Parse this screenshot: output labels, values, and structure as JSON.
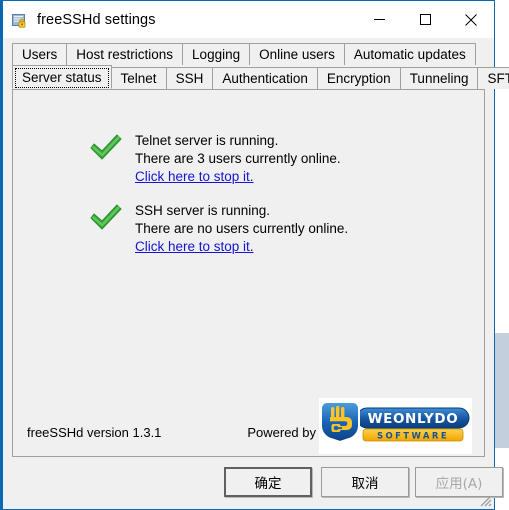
{
  "window": {
    "title": "freeSSHd settings",
    "icon": "app-lock-icon",
    "controls": {
      "minimize": "—",
      "maximize": "□",
      "close": "✕"
    },
    "border_color": "#0a67b2"
  },
  "tabs": {
    "row1": [
      {
        "label": "Users",
        "selected": false
      },
      {
        "label": "Host restrictions",
        "selected": false
      },
      {
        "label": "Logging",
        "selected": false
      },
      {
        "label": "Online users",
        "selected": false
      },
      {
        "label": "Automatic updates",
        "selected": false
      }
    ],
    "row2": [
      {
        "label": "Server status",
        "selected": true
      },
      {
        "label": "Telnet",
        "selected": false
      },
      {
        "label": "SSH",
        "selected": false
      },
      {
        "label": "Authentication",
        "selected": false
      },
      {
        "label": "Encryption",
        "selected": false
      },
      {
        "label": "Tunneling",
        "selected": false
      },
      {
        "label": "SFTP",
        "selected": false
      }
    ]
  },
  "server_status": {
    "telnet": {
      "icon": "green-check-icon",
      "line1": "Telnet server is running.",
      "line2": "There are 3 users currently online.",
      "link": "Click here to stop it."
    },
    "ssh": {
      "icon": "green-check-icon",
      "line1": "SSH server is running.",
      "line2": "There are no users currently online.",
      "link": "Click here to stop it."
    }
  },
  "footer": {
    "version": "freeSSHd version 1.3.1",
    "powered_by": "Powered by",
    "logo": {
      "name": "WEONLYDO",
      "tagline": "SOFTWARE",
      "blue": "#1560bd",
      "yellow": "#ffc423"
    }
  },
  "buttons": [
    {
      "label": "确定",
      "state": "default"
    },
    {
      "label": "取消",
      "state": "normal"
    },
    {
      "label": "应用(A)",
      "state": "disabled"
    }
  ],
  "colors": {
    "accent": "#0a67b2",
    "link": "#1414d2",
    "check": "#3eb03e",
    "face": "#f0f0f0"
  }
}
